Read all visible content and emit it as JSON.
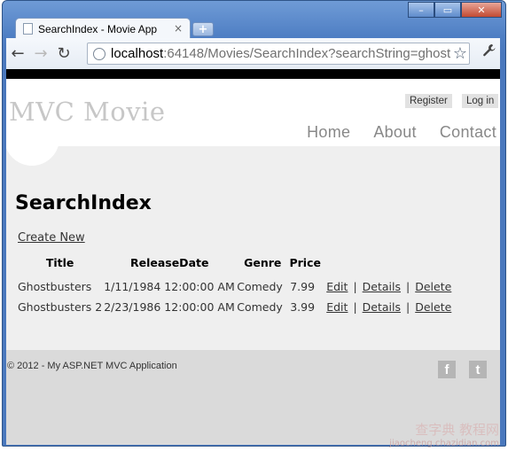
{
  "window": {
    "minimize": "–",
    "maximize": "▭",
    "close": "✕"
  },
  "tab": {
    "title": "SearchIndex - Movie App",
    "close": "×",
    "new_tab": "+"
  },
  "toolbar": {
    "back": "←",
    "forward": "→",
    "reload": "↻",
    "url_host": "localhost",
    "url_path": ":64148/Movies/SearchIndex?searchString=ghost",
    "star": "☆",
    "wrench": "🔧"
  },
  "site": {
    "title": "MVC Movie",
    "register": "Register",
    "login": "Log in",
    "nav": [
      "Home",
      "About",
      "Contact"
    ]
  },
  "content": {
    "heading": "SearchIndex",
    "create_new": "Create New",
    "columns": [
      "Title",
      "ReleaseDate",
      "Genre",
      "Price"
    ],
    "rows": [
      {
        "title": "Ghostbusters",
        "date": "1/11/1984 12:00:00 AM",
        "genre": "Comedy",
        "price": "7.99"
      },
      {
        "title": "Ghostbusters 2",
        "date": "2/23/1986 12:00:00 AM",
        "genre": "Comedy",
        "price": "3.99"
      }
    ],
    "actions": {
      "edit": "Edit",
      "details": "Details",
      "delete": "Delete",
      "sep": "|"
    }
  },
  "footer": {
    "copyright": "© 2012 - My ASP.NET MVC Application",
    "facebook": "f",
    "twitter": "t"
  },
  "watermark": {
    "line1": "查字典 教程网",
    "line2": "jiaocheng.chazidian.com"
  }
}
